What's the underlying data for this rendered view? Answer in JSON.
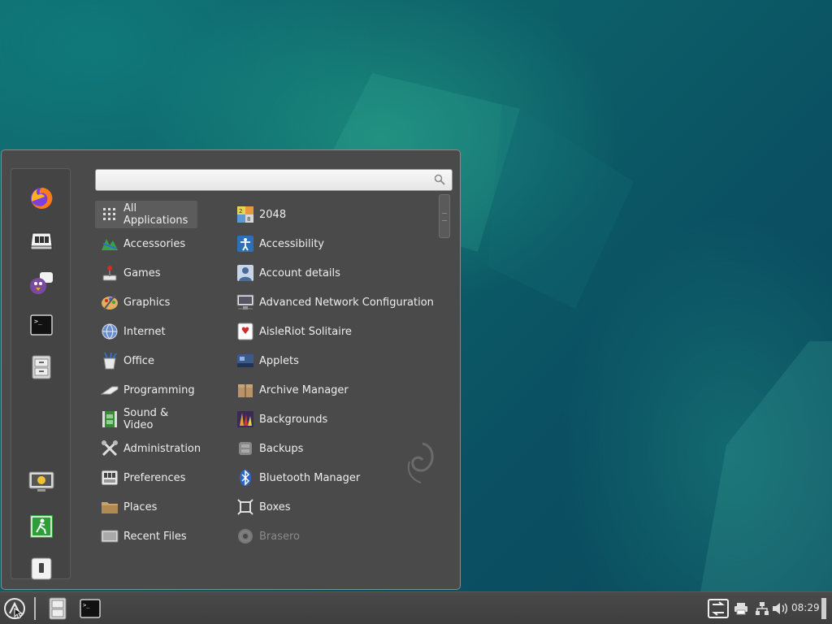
{
  "search": {
    "placeholder": "",
    "value": ""
  },
  "favorites": [
    {
      "name": "firefox-icon"
    },
    {
      "name": "software-manager-icon"
    },
    {
      "name": "pidgin-icon"
    },
    {
      "name": "terminal-icon"
    },
    {
      "name": "file-manager-icon"
    },
    {
      "name": "lock-screen-icon"
    },
    {
      "name": "logout-icon"
    },
    {
      "name": "shutdown-icon"
    }
  ],
  "categories": [
    {
      "label": "All Applications",
      "icon": "grid-icon",
      "active": true
    },
    {
      "label": "Accessories",
      "icon": "accessories-icon"
    },
    {
      "label": "Games",
      "icon": "games-icon"
    },
    {
      "label": "Graphics",
      "icon": "graphics-icon"
    },
    {
      "label": "Internet",
      "icon": "internet-icon"
    },
    {
      "label": "Office",
      "icon": "office-icon"
    },
    {
      "label": "Programming",
      "icon": "programming-icon"
    },
    {
      "label": "Sound & Video",
      "icon": "sound-video-icon"
    },
    {
      "label": "Administration",
      "icon": "administration-icon"
    },
    {
      "label": "Preferences",
      "icon": "preferences-icon"
    },
    {
      "label": "Places",
      "icon": "folder-icon"
    },
    {
      "label": "Recent Files",
      "icon": "recent-files-icon"
    }
  ],
  "apps": [
    {
      "label": "2048",
      "icon": "game-2048-icon"
    },
    {
      "label": "Accessibility",
      "icon": "accessibility-icon"
    },
    {
      "label": "Account details",
      "icon": "account-icon"
    },
    {
      "label": "Advanced Network Configuration",
      "icon": "network-config-icon"
    },
    {
      "label": "AisleRiot Solitaire",
      "icon": "solitaire-icon"
    },
    {
      "label": "Applets",
      "icon": "applets-icon"
    },
    {
      "label": "Archive Manager",
      "icon": "archive-icon"
    },
    {
      "label": "Backgrounds",
      "icon": "backgrounds-icon"
    },
    {
      "label": "Backups",
      "icon": "backups-icon"
    },
    {
      "label": "Bluetooth Manager",
      "icon": "bluetooth-icon"
    },
    {
      "label": "Boxes",
      "icon": "boxes-icon"
    },
    {
      "label": "Brasero",
      "icon": "brasero-icon",
      "disabled": true
    }
  ],
  "taskbar": {
    "clock": "08:29"
  }
}
